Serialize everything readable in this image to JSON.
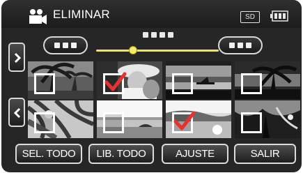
{
  "title_bar": {
    "mode_icon": "movie-camera-icon",
    "title": "ELIMINAR",
    "media_badge": "SD",
    "battery_icon": "battery-icon"
  },
  "navigation": {
    "prev_page_button": "prev-page-pill",
    "next_page_button": "next-page-pill",
    "scroll_up_icon": "chevron-right-icon",
    "scroll_down_icon": "chevron-left-icon",
    "slider_position": 0.3,
    "accent_color": "#f3e64a"
  },
  "thumbnails": [
    {
      "scene": "palm-beach-dark",
      "selected": false
    },
    {
      "scene": "people-with-hat",
      "selected": true
    },
    {
      "scene": "boat-at-sunset",
      "selected": false
    },
    {
      "scene": "palm-silhouette",
      "selected": false
    },
    {
      "scene": "palm-leaves-sunny",
      "selected": false
    },
    {
      "scene": "beach-horizon",
      "selected": false
    },
    {
      "scene": "bright-water",
      "selected": true
    },
    {
      "scene": "dark-tree",
      "selected": false
    }
  ],
  "checkmark_color": "#e8312f",
  "buttons": {
    "select_all": "SEL. TODO",
    "deselect_all": "LIB. TODO",
    "set": "AJUSTE",
    "exit": "SALIR"
  }
}
